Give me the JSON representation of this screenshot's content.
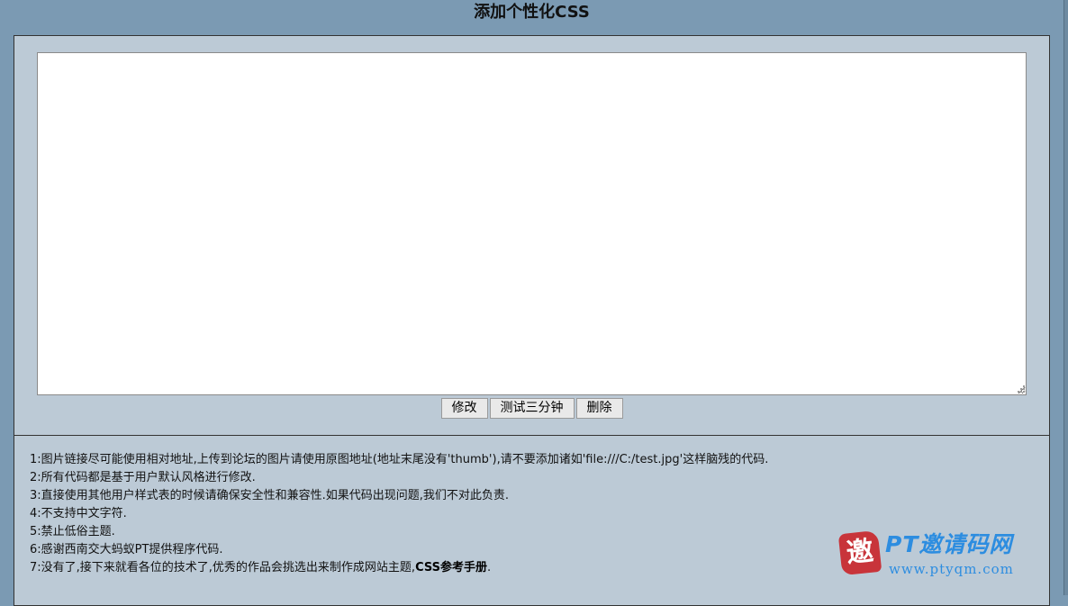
{
  "page": {
    "title": "添加个性化CSS"
  },
  "editor": {
    "value": ""
  },
  "buttons": {
    "modify": "修改",
    "test": "测试三分钟",
    "delete": "删除"
  },
  "notes": {
    "items": [
      "1:图片链接尽可能使用相对地址,上传到论坛的图片请使用原图地址(地址末尾没有'thumb'),请不要添加诸如'file:///C:/test.jpg'这样脑残的代码.",
      "2:所有代码都是基于用户默认风格进行修改.",
      "3:直接使用其他用户样式表的时候请确保安全性和兼容性.如果代码出现问题,我们不对此负责.",
      "4:不支持中文字符.",
      "5:禁止低俗主题.",
      "6:感谢西南交大蚂蚁PT提供程序代码."
    ],
    "last": {
      "text": "7:没有了,接下来就看各位的技术了,优秀的作品会挑选出来制作成网站主题,",
      "link": "CSS参考手册",
      "suffix": "."
    }
  },
  "watermark": {
    "seal_char": "邀",
    "title": "PT邀请码网",
    "url": "www.ptyqm.com"
  },
  "colors": {
    "background": "#7b9ab3",
    "panel": "#bccad6",
    "watermark_blue": "#2d8de0",
    "seal_red": "#c8343a"
  }
}
